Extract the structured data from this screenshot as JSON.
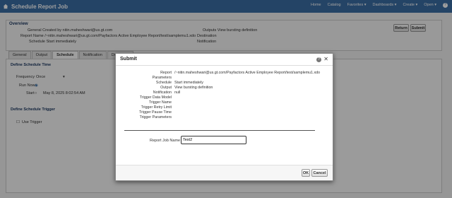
{
  "header": {
    "title": "Schedule Report Job",
    "menus": [
      "Home",
      "Catalog",
      "Favorites ▾",
      "Dashboards ▾",
      "Create ▾",
      "Open ▾"
    ]
  },
  "overview": {
    "title": "Overview",
    "general": "General Created by nitin.maheshwari@us.gt.com",
    "report_name": "Report Name /~nitin.maheshwari@us.gt.com/Payfactors Active Employee Report/test/samplemu1.xdo",
    "schedule": "Schedule Start immediately",
    "output": "Outputs View bursting definition",
    "destination": "Destination",
    "notification": "Notification",
    "return_label": "Return",
    "submit_label": "Submit"
  },
  "tabs": [
    "General",
    "Output",
    "Schedule",
    "Notification",
    "Diagnostic"
  ],
  "schedule_section": {
    "title": "Define Schedule Time",
    "frequency_label": "Frequency",
    "frequency_value": "Once",
    "run_now_label": "Run Now",
    "start_label": "Start",
    "start_value": "May 8, 2025 8:02:54 AM",
    "trigger_title": "Define Schedule Trigger",
    "use_trigger_label": "Use Trigger"
  },
  "modal": {
    "title": "Submit",
    "rows": [
      {
        "label": "Report",
        "value": "/~nitin.maheshwari@us.gt.com/Payfactors Active Employee Report/test/samplemu1.xdo"
      },
      {
        "label": "Parameters",
        "value": ""
      },
      {
        "label": "Schedule",
        "value": "Start immediately"
      },
      {
        "label": "Output",
        "value": "View bursting definition"
      },
      {
        "label": "Notification",
        "value": "null"
      },
      {
        "label": "Trigger Data Model",
        "value": ""
      },
      {
        "label": "Trigger Name",
        "value": ""
      },
      {
        "label": "Trigger Retry Limit",
        "value": ""
      },
      {
        "label": "Trigger Pause Time",
        "value": ""
      },
      {
        "label": "Trigger Parameters",
        "value": ""
      }
    ],
    "job_name_label": "Report Job Name",
    "job_name_value": "Test2",
    "ok_label": "OK",
    "cancel_label": "Cancel"
  }
}
